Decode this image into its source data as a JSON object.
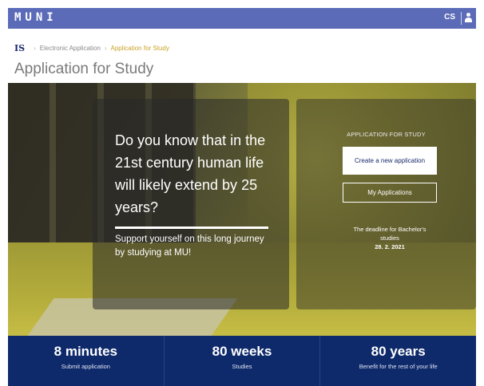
{
  "header": {
    "logo": "MUNI",
    "language": "CS"
  },
  "breadcrumb": {
    "home": "IS",
    "items": [
      "Electronic Application",
      "Application for Study"
    ]
  },
  "page_title": "Application for Study",
  "hero": {
    "headline": "Do you know that in the 21st century human life will likely extend by 25 years?",
    "subtext": "Support yourself on this long journey by studying at MU!"
  },
  "application": {
    "label": "APPLICATION FOR STUDY",
    "create_button": "Create a new application",
    "my_button": "My Applications",
    "deadline_text": "The deadline for Bachelor's studies",
    "deadline_date": "28. 2. 2021"
  },
  "stats": [
    {
      "value": "8 minutes",
      "caption": "Submit application"
    },
    {
      "value": "80 weeks",
      "caption": "Studies"
    },
    {
      "value": "80 years",
      "caption": "Benefit for the rest of your life"
    }
  ],
  "colors": {
    "topbar": "#5b6bb8",
    "stats_bar": "#0f2a6b",
    "breadcrumb_active": "#c9a227",
    "hero_tint": "#a8a23a"
  },
  "icons": [
    "user-icon"
  ]
}
